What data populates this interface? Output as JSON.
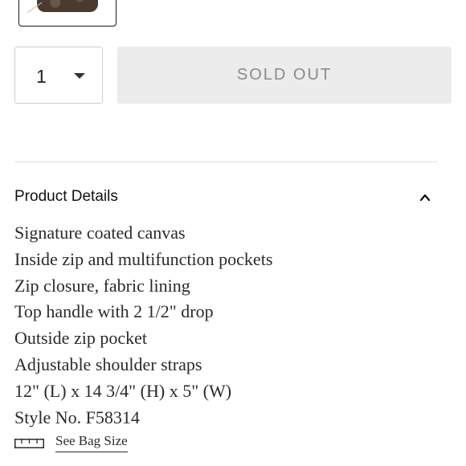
{
  "quantity": {
    "value": "1"
  },
  "purchase": {
    "button_label": "SOLD OUT"
  },
  "product_details": {
    "title": "Product Details",
    "items": [
      "Signature coated canvas",
      "Inside zip and multifunction pockets",
      "Zip closure, fabric lining",
      "Top handle with 2 1/2\" drop",
      "Outside zip pocket",
      "Adjustable shoulder straps",
      "12\" (L) x 14 3/4\" (H) x 5\" (W)",
      "Style No. F58314"
    ],
    "size_link": "See Bag Size"
  },
  "icons": {
    "quantity_dropdown": "chevron-down-icon",
    "collapse": "chevron-up-icon",
    "size": "ruler-icon"
  },
  "colors": {
    "sold_out_bg": "#ececec",
    "sold_out_text": "#8a8a8a",
    "divider": "#dedede"
  }
}
